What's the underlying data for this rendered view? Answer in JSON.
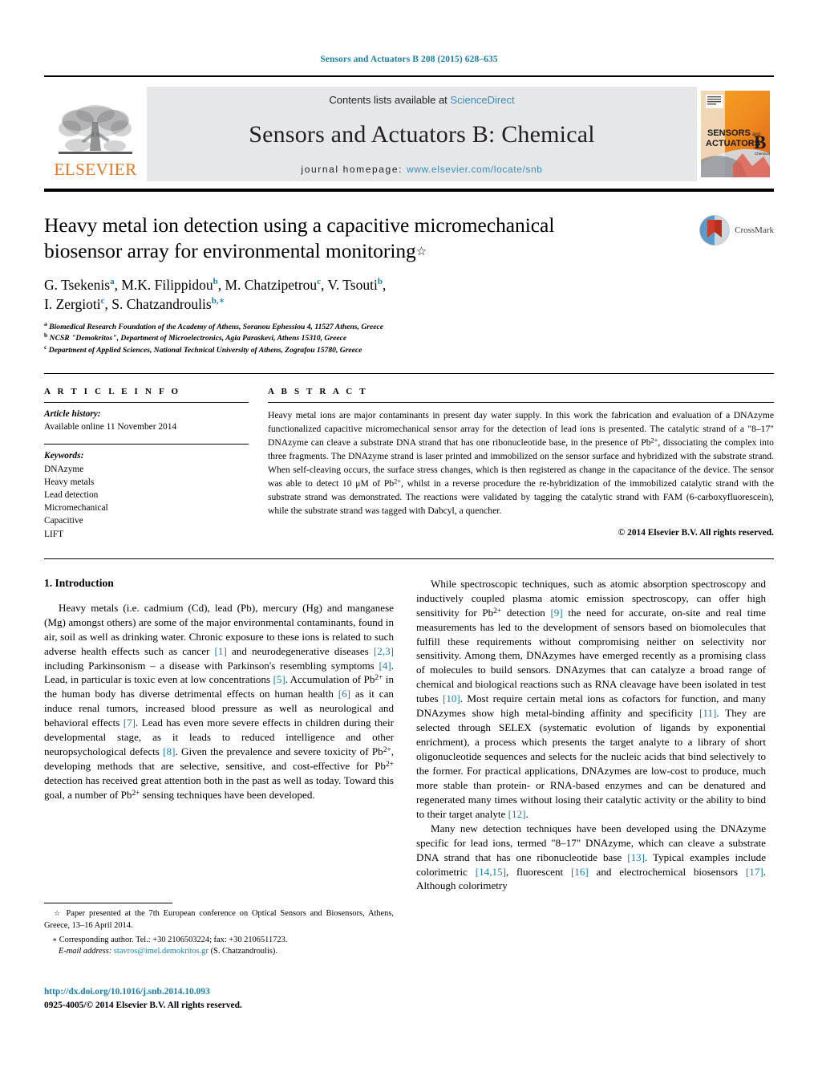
{
  "running_head": "Sensors and Actuators B 208 (2015) 628–635",
  "masthead": {
    "elsevier_wordmark": "ELSEVIER",
    "contents_prefix": "Contents lists available at ",
    "contents_link": "ScienceDirect",
    "journal_title": "Sensors and Actuators B: Chemical",
    "homepage_label": "journal homepage:",
    "homepage_url": "www.elsevier.com/locate/snb",
    "cover_line1": "SENSORS",
    "cover_and": "and",
    "cover_line2": "ACTUATORS",
    "cover_letter": "B",
    "cover_sub": "Chemical"
  },
  "article": {
    "title_line1": "Heavy metal ion detection using a capacitive micromechanical",
    "title_line2": "biosensor array for environmental monitoring",
    "title_marker": "☆",
    "authors_line1": [
      {
        "name": "G. Tsekenis",
        "sup": "a",
        "sep": ", "
      },
      {
        "name": "M.K. Filippidou",
        "sup": "b",
        "sep": ", "
      },
      {
        "name": "M. Chatzipetrou",
        "sup": "c",
        "sep": ", "
      },
      {
        "name": "V. Tsouti",
        "sup": "b",
        "sep": ","
      }
    ],
    "authors_line2": [
      {
        "name": "I. Zergioti",
        "sup": "c",
        "sep": ", "
      },
      {
        "name": "S. Chatzandroulis",
        "sup": "b,",
        "sep": ""
      }
    ],
    "affiliations": [
      {
        "marker": "a",
        "text": "Biomedical Research Foundation of the Academy of Athens, Soranou Ephessiou 4, 11527 Athens, Greece"
      },
      {
        "marker": "b",
        "text": "NCSR \"Demokritos\", Department of Microelectronics, Agia Paraskevi, Athens 15310, Greece"
      },
      {
        "marker": "c",
        "text": "Department of Applied Sciences, National Technical University of Athens, Zografou 15780, Greece"
      }
    ],
    "crossmark_label": "CrossMark"
  },
  "article_info": {
    "heading": "A R T I C L E   I N F O",
    "history_label": "Article history:",
    "history_value": "Available online 11 November 2014",
    "keywords_label": "Keywords:",
    "keywords": [
      "DNAzyme",
      "Heavy metals",
      "Lead detection",
      "Micromechanical",
      "Capacitive",
      "LIFT"
    ]
  },
  "abstract": {
    "heading": "A B S T R A C T",
    "text": "Heavy metal ions are major contaminants in present day water supply. In this work the fabrication and evaluation of a DNAzyme functionalized capacitive micromechanical sensor array for the detection of lead ions is presented. The catalytic strand of a \"8–17\" DNAzyme can cleave a substrate DNA strand that has one ribonucleotide base, in the presence of Pb2+, dissociating the complex into three fragments. The DNAzyme strand is laser printed and immobilized on the sensor surface and hybridized with the substrate strand. When self-cleaving occurs, the surface stress changes, which is then registered as change in the capacitance of the device. The sensor was able to detect 10 μM of Pb2+, whilst in a reverse procedure the re-hybridization of the immobilized catalytic strand with the substrate strand was demonstrated. The reactions were validated by tagging the catalytic strand with FAM (6-carboxyfluorescein), while the substrate strand was tagged with Dabcyl, a quencher.",
    "copyright": "© 2014 Elsevier B.V. All rights reserved."
  },
  "body": {
    "section_heading": "1.  Introduction",
    "left_paragraphs": [
      "Heavy metals (i.e. cadmium (Cd), lead (Pb), mercury (Hg) and manganese (Mg) amongst others) are some of the major environmental contaminants, found in air, soil as well as drinking water. Chronic exposure to these ions is related to such adverse health effects such as cancer [1] and neurodegenerative diseases [2,3] including Parkinsonism – a disease with Parkinson's resembling symptoms [4]. Lead, in particular is toxic even at low concentrations [5]. Accumulation of Pb2+ in the human body has diverse detrimental effects on human health [6] as it can induce renal tumors, increased blood pressure as well as neurological and behavioral effects [7]. Lead has even more severe effects in children during their developmental stage, as it leads to reduced intelligence and other neuropsychological defects [8]. Given the prevalence and severe toxicity of Pb2+, developing methods that are selective, sensitive, and cost-effective for Pb2+ detection has received great attention both in the past as well as today. Toward this goal, a number of Pb2+ sensing techniques have been developed."
    ],
    "right_paragraphs": [
      "While spectroscopic techniques, such as atomic absorption spectroscopy and inductively coupled plasma atomic emission spectroscopy, can offer high sensitivity for Pb2+ detection [9] the need for accurate, on-site and real time measurements has led to the development of sensors based on biomolecules that fulfill these requirements without compromising neither on selectivity nor sensitivity. Among them, DNAzymes have emerged recently as a promising class of molecules to build sensors. DNAzymes that can catalyze a broad range of chemical and biological reactions such as RNA cleavage have been isolated in test tubes [10]. Most require certain metal ions as cofactors for function, and many DNAzymes show high metal-binding affinity and specificity [11]. They are selected through SELEX (systematic evolution of ligands by exponential enrichment), a process which presents the target analyte to a library of short oligonucleotide sequences and selects for the nucleic acids that bind selectively to the former. For practical applications, DNAzymes are low-cost to produce, much more stable than protein- or RNA-based enzymes and can be denatured and regenerated many times without losing their catalytic activity or the ability to bind to their target analyte [12].",
      "Many new detection techniques have been developed using the DNAzyme specific for lead ions, termed \"8–17\" DNAzyme, which can cleave a substrate DNA strand that has one ribonucleotide base [13]. Typical examples include colorimetric [14,15], fluorescent [16] and electrochemical biosensors [17]. Although colorimetry"
    ]
  },
  "footnotes": {
    "conference_marker": "☆",
    "conference_text": "Paper presented at the 7th European conference on Optical Sensors and Biosensors, Athens, Greece, 13–16 April 2014.",
    "corresponding_marker": "∗",
    "corresponding_text": "Corresponding author. Tel.: +30 2106503224; fax: +30 2106511723.",
    "email_label": "E-mail address:",
    "email": "stavros@imel.demokritos.gr",
    "email_suffix": "(S. Chatzandroulis)."
  },
  "publisher": {
    "doi": "http://dx.doi.org/10.1016/j.snb.2014.10.093",
    "issn_line": "0925-4005/© 2014 Elsevier B.V. All rights reserved."
  },
  "colors": {
    "link": "#1a7fa8",
    "elsevier_orange": "#E87722",
    "band_gray": "#e6e7e8",
    "sciencedirect_blue": "#3a8dbb"
  }
}
